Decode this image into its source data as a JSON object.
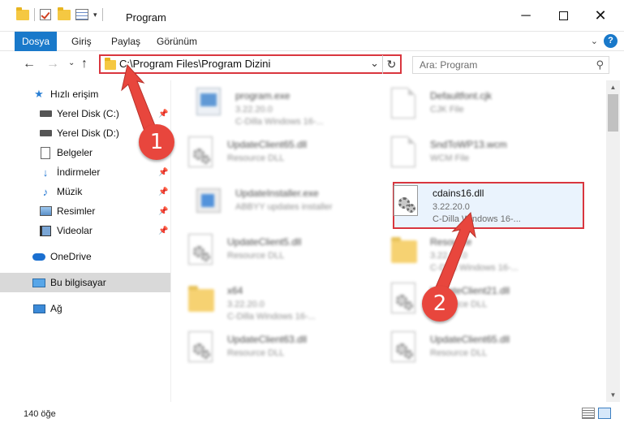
{
  "window": {
    "title": "Program",
    "minimize_icon": "minimize-icon",
    "maximize_icon": "maximize-icon",
    "close_icon": "close-icon"
  },
  "ribbon": {
    "tabs": [
      "Dosya",
      "Giriş",
      "Paylaş",
      "Görünüm"
    ],
    "help_label": "?"
  },
  "address": {
    "path": "C:\\Program Files\\Program Dizini",
    "search_placeholder": "Ara: Program"
  },
  "nav": {
    "items": [
      {
        "label": "Hızlı erişim",
        "icon": "star-icon"
      },
      {
        "label": "Yerel Disk (C:)",
        "icon": "drive-icon"
      },
      {
        "label": "Yerel Disk (D:)",
        "icon": "drive-icon"
      },
      {
        "label": "Belgeler",
        "icon": "documents-icon"
      },
      {
        "label": "İndirmeler",
        "icon": "download-icon"
      },
      {
        "label": "Müzik",
        "icon": "music-icon"
      },
      {
        "label": "Resimler",
        "icon": "pictures-icon"
      },
      {
        "label": "Videolar",
        "icon": "videos-icon"
      },
      {
        "label": "OneDrive",
        "icon": "cloud-icon"
      },
      {
        "label": "Bu bilgisayar",
        "icon": "computer-icon"
      },
      {
        "label": "Ağ",
        "icon": "network-icon"
      }
    ]
  },
  "files": [
    {
      "name": "program.exe",
      "line2": "3.22.20.0",
      "line3": "C-Dilla Windows 16-..."
    },
    {
      "name": "Defaultfont.cjk",
      "line2": "CJK File",
      "line3": ""
    },
    {
      "name": "UpdateClient65.dll",
      "line2": "Resource DLL",
      "line3": ""
    },
    {
      "name": "SndToWP13.wcm",
      "line2": "WCM File",
      "line3": ""
    },
    {
      "name": "UpdateInstaller.exe",
      "line2": "ABBYY updates installer",
      "line3": ""
    },
    {
      "name": "cdains16.dll",
      "line2": "3.22.20.0",
      "line3": "C-Dilla Windows 16-..."
    },
    {
      "name": "UpdateClient5.dll",
      "line2": "Resource DLL",
      "line3": ""
    },
    {
      "name": "Resource",
      "line2": "3.22.20.0",
      "line3": "C-Dilla Windows 16-..."
    },
    {
      "name": "x64",
      "line2": "3.22.20.0",
      "line3": "C-Dilla Windows 16-..."
    },
    {
      "name": "UpdateClient21.dll",
      "line2": "Resource DLL",
      "line3": ""
    },
    {
      "name": "UpdateClient63.dll",
      "line2": "Resource DLL",
      "line3": ""
    },
    {
      "name": "UpdateClient65.dll",
      "line2": "Resource DLL",
      "line3": ""
    }
  ],
  "status": {
    "count": "140 öğe"
  },
  "callouts": [
    "1",
    "2"
  ],
  "colors": {
    "accent": "#1979ca",
    "highlight_border": "#d9363e",
    "callout": "#e8463d"
  }
}
